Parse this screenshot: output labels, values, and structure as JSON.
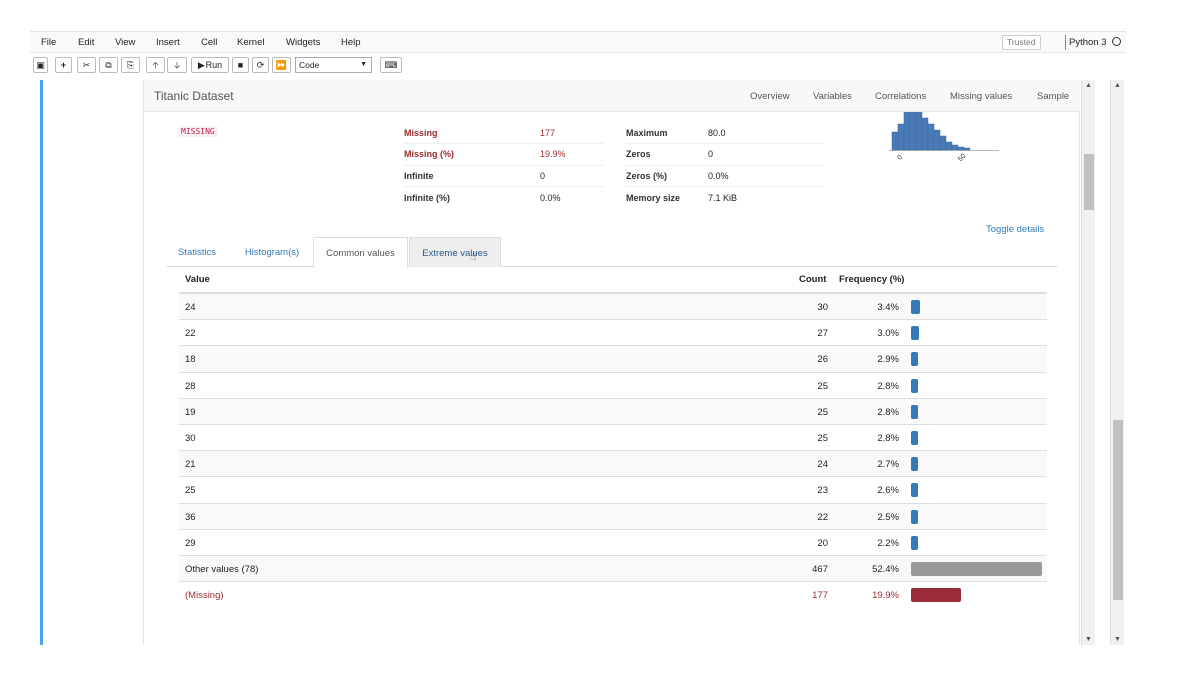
{
  "menubar": {
    "items": [
      "File",
      "Edit",
      "View",
      "Insert",
      "Cell",
      "Kernel",
      "Widgets",
      "Help"
    ],
    "trusted": "Trusted",
    "kernel": "Python 3"
  },
  "toolbar": {
    "run_label": "Run",
    "cell_type": "Code"
  },
  "report": {
    "title": "Titanic Dataset",
    "nav": [
      "Overview",
      "Variables",
      "Correlations",
      "Missing values",
      "Sample"
    ],
    "missing_tag": "MISSING",
    "stats_left": [
      {
        "label": "Missing",
        "value": "177",
        "alert": true
      },
      {
        "label": "Missing (%)",
        "value": "19.9%",
        "alert": true
      },
      {
        "label": "Infinite",
        "value": "0",
        "alert": false
      },
      {
        "label": "Infinite (%)",
        "value": "0.0%",
        "alert": false
      }
    ],
    "stats_right": [
      {
        "label": "Maximum",
        "value": "80.0"
      },
      {
        "label": "Zeros",
        "value": "0"
      },
      {
        "label": "Zeros (%)",
        "value": "0.0%"
      },
      {
        "label": "Memory size",
        "value": "7.1 KiB"
      }
    ],
    "hist_ticks": [
      "0",
      "50"
    ],
    "toggle_details": "Toggle details",
    "tabs": [
      "Statistics",
      "Histogram(s)",
      "Common values",
      "Extreme values"
    ],
    "active_tab": "Common values",
    "table_headers": {
      "value": "Value",
      "count": "Count",
      "frequency": "Frequency (%)"
    },
    "rows": [
      {
        "value": "24",
        "count": "30",
        "freq": "3.4%",
        "pct": 3.4
      },
      {
        "value": "22",
        "count": "27",
        "freq": "3.0%",
        "pct": 3.0
      },
      {
        "value": "18",
        "count": "26",
        "freq": "2.9%",
        "pct": 2.9
      },
      {
        "value": "28",
        "count": "25",
        "freq": "2.8%",
        "pct": 2.8
      },
      {
        "value": "19",
        "count": "25",
        "freq": "2.8%",
        "pct": 2.8
      },
      {
        "value": "30",
        "count": "25",
        "freq": "2.8%",
        "pct": 2.8
      },
      {
        "value": "21",
        "count": "24",
        "freq": "2.7%",
        "pct": 2.7
      },
      {
        "value": "25",
        "count": "23",
        "freq": "2.6%",
        "pct": 2.6
      },
      {
        "value": "36",
        "count": "22",
        "freq": "2.5%",
        "pct": 2.5
      },
      {
        "value": "29",
        "count": "20",
        "freq": "2.2%",
        "pct": 2.2
      },
      {
        "value": "Other values (78)",
        "count": "467",
        "freq": "52.4%",
        "pct": 52.4,
        "kind": "other"
      },
      {
        "value": "(Missing)",
        "count": "177",
        "freq": "19.9%",
        "pct": 19.9,
        "kind": "missing"
      }
    ]
  }
}
